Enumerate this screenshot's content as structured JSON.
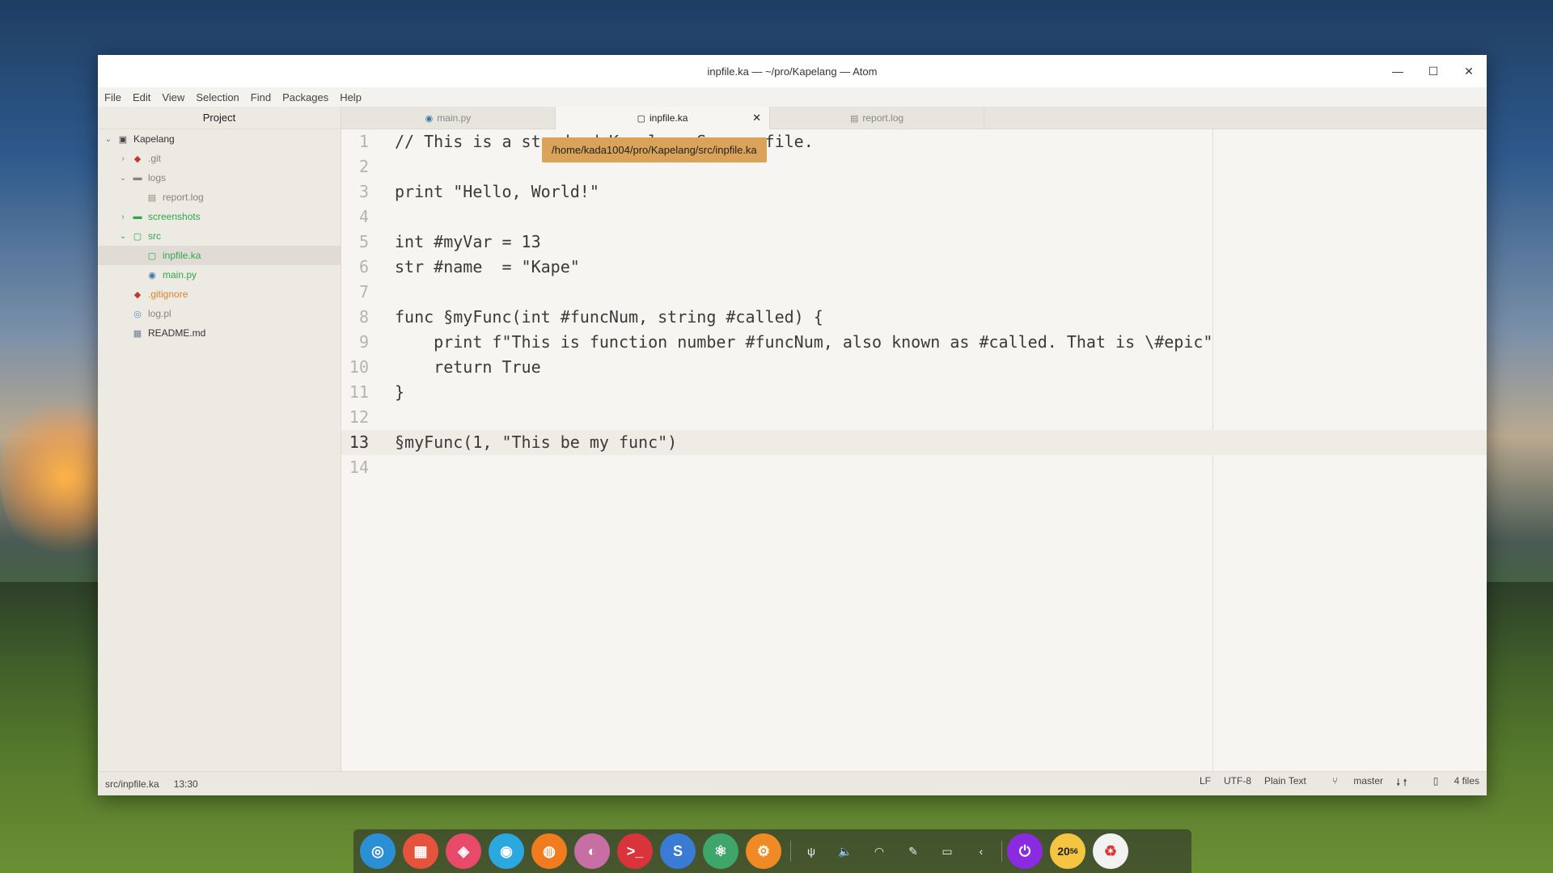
{
  "window": {
    "title": "inpfile.ka — ~/pro/Kapelang — Atom",
    "controls": {
      "minimize": "—",
      "maximize": "☐",
      "close": "✕"
    }
  },
  "menu": [
    "File",
    "Edit",
    "View",
    "Selection",
    "Find",
    "Packages",
    "Help"
  ],
  "sidebar": {
    "header": "Project",
    "root": "Kapelang",
    "items": [
      {
        "label": ".git",
        "icon": "git-icon",
        "glyph": "◆",
        "chev": "›",
        "color": "muted"
      },
      {
        "label": "logs",
        "icon": "folder-icon",
        "glyph": "▬",
        "chev": "⌄",
        "color": "muted"
      },
      {
        "label": "report.log",
        "icon": "file-text-icon",
        "glyph": "▤",
        "chev": "",
        "color": "muted"
      },
      {
        "label": "screenshots",
        "icon": "folder-icon",
        "glyph": "▬",
        "chev": "›",
        "color": "green"
      },
      {
        "label": "src",
        "icon": "folder-open-icon",
        "glyph": "▢",
        "chev": "⌄",
        "color": "green"
      },
      {
        "label": "inpfile.ka",
        "icon": "file-icon",
        "glyph": "▢",
        "chev": "",
        "color": "green"
      },
      {
        "label": "main.py",
        "icon": "python-icon",
        "glyph": "◉",
        "chev": "",
        "color": "green"
      },
      {
        "label": ".gitignore",
        "icon": "git-icon",
        "glyph": "◆",
        "chev": "",
        "color": "orange"
      },
      {
        "label": "log.pl",
        "icon": "perl-icon",
        "glyph": "◎",
        "chev": "",
        "color": "muted"
      },
      {
        "label": "README.md",
        "icon": "markdown-icon",
        "glyph": "▦",
        "chev": "",
        "color": "dark"
      }
    ]
  },
  "tabs": [
    {
      "label": "main.py",
      "icon": "python-icon",
      "glyph": "◉"
    },
    {
      "label": "inpfile.ka",
      "icon": "file-icon",
      "glyph": "▢"
    },
    {
      "label": "report.log",
      "icon": "file-text-icon",
      "glyph": "▤"
    }
  ],
  "tab_close": "✕",
  "tooltip": "/home/kada1004/pro/Kapelang/src/inpfile.ka",
  "editor": {
    "lines": [
      {
        "n": "1",
        "text": "// This is a standard Kapelang Source file."
      },
      {
        "n": "2",
        "text": ""
      },
      {
        "n": "3",
        "text": "print \"Hello, World!\""
      },
      {
        "n": "4",
        "text": ""
      },
      {
        "n": "5",
        "text": "int #myVar = 13"
      },
      {
        "n": "6",
        "text": "str #name  = \"Kape\""
      },
      {
        "n": "7",
        "text": ""
      },
      {
        "n": "8",
        "text": "func §myFunc(int #funcNum, string #called) {"
      },
      {
        "n": "9",
        "text": "    print f\"This is function number #funcNum, also known as #called. That is \\#epic\""
      },
      {
        "n": "10",
        "text": "    return True"
      },
      {
        "n": "11",
        "text": "}"
      },
      {
        "n": "12",
        "text": ""
      },
      {
        "n": "13",
        "text": "§myFunc(1, \"This be my func\")"
      },
      {
        "n": "14",
        "text": ""
      }
    ],
    "current_line": 13
  },
  "status": {
    "path": "src/inpfile.ka",
    "cursor": "13:30",
    "line_ending": "LF",
    "encoding": "UTF-8",
    "grammar": "Plain Text",
    "branch": "master",
    "fetch": "🠗 🠕",
    "files": "4 files"
  },
  "dock": {
    "apps": [
      {
        "name": "launcher-icon",
        "glyph": "◎",
        "color": "#2b8fd6"
      },
      {
        "name": "multitask-icon",
        "glyph": "▦",
        "color": "#e5533d"
      },
      {
        "name": "app-store-icon",
        "glyph": "◈",
        "color": "#e84a6a"
      },
      {
        "name": "file-manager-icon",
        "glyph": "◉",
        "color": "#2aa8e0"
      },
      {
        "name": "firefox-icon",
        "glyph": "◍",
        "color": "#f07c1e"
      },
      {
        "name": "image-viewer-icon",
        "glyph": "◐",
        "color": "#c76fa5"
      },
      {
        "name": "terminal-icon",
        "glyph": ">_",
        "color": "#d9343c"
      },
      {
        "name": "simplenote-icon",
        "glyph": "S",
        "color": "#3a7bd5"
      },
      {
        "name": "atom-icon",
        "glyph": "⚛",
        "color": "#3ea66a"
      },
      {
        "name": "settings-icon",
        "glyph": "⚙",
        "color": "#f08a24"
      }
    ],
    "tray": [
      {
        "name": "usb-icon",
        "glyph": "ψ"
      },
      {
        "name": "volume-icon",
        "glyph": "🔈"
      },
      {
        "name": "wifi-icon",
        "glyph": "◠"
      },
      {
        "name": "pen-icon",
        "glyph": "✎"
      },
      {
        "name": "keyboard-icon",
        "glyph": "▭"
      },
      {
        "name": "expand-icon",
        "glyph": "‹"
      }
    ],
    "power": "⏻",
    "clock": "20",
    "clock_minutes": "56",
    "trash": "♻"
  }
}
